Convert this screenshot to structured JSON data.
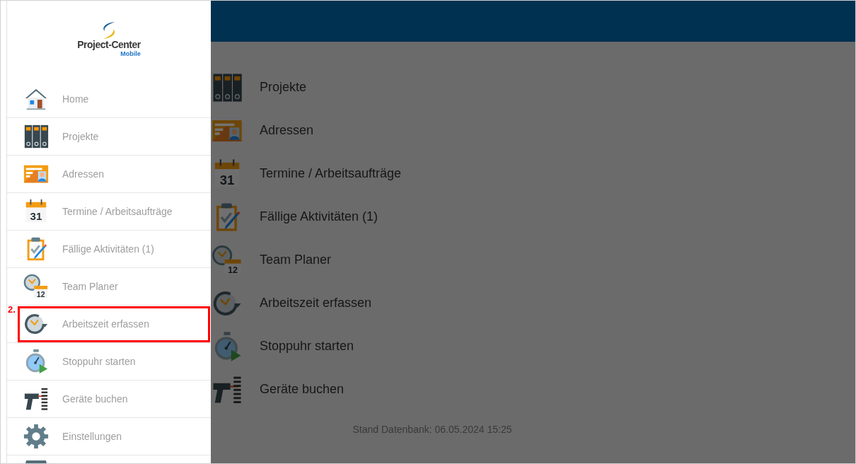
{
  "logo": {
    "name": "Project-Center",
    "sub": "Mobile"
  },
  "drawer": {
    "items": [
      {
        "label": "Home",
        "marked": false
      },
      {
        "label": "Projekte",
        "marked": false
      },
      {
        "label": "Adressen",
        "marked": false
      },
      {
        "label": "Termine / Arbeitsaufträge",
        "icon_label": "31",
        "marked": false
      },
      {
        "label": "Fällige Aktivitäten (1)",
        "marked": false
      },
      {
        "label": "Team Planer",
        "icon_label": "12",
        "marked": false
      },
      {
        "label": "Arbeitszeit erfassen",
        "marked": true
      },
      {
        "label": "Stoppuhr starten",
        "marked": false
      },
      {
        "label": "Geräte buchen",
        "marked": false
      },
      {
        "label": "Einstellungen",
        "marked": false
      }
    ]
  },
  "annotation": {
    "label": "2."
  },
  "menu": {
    "items": [
      {
        "label": "Projekte"
      },
      {
        "label": "Adressen"
      },
      {
        "label": "Termine / Arbeitsaufträge",
        "icon_label": "31"
      },
      {
        "label": "Fällige Aktivitäten (1)"
      },
      {
        "label": "Team Planer",
        "icon_label": "12"
      },
      {
        "label": "Arbeitszeit erfassen"
      },
      {
        "label": "Stoppuhr starten"
      },
      {
        "label": "Geräte buchen"
      }
    ]
  },
  "footer": "Stand Datenbank: 06.05.2024 15:25"
}
